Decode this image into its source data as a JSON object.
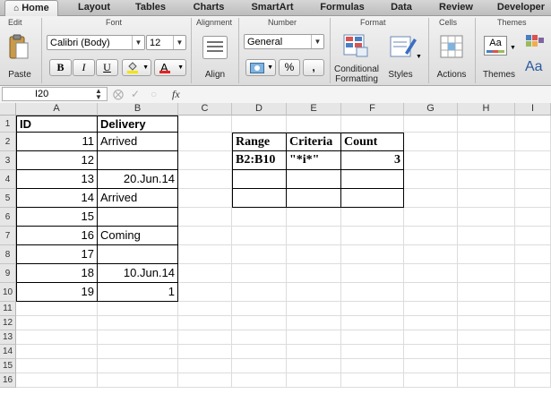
{
  "tabs": [
    {
      "label": "Home",
      "active": true
    },
    {
      "label": "Layout"
    },
    {
      "label": "Tables"
    },
    {
      "label": "Charts"
    },
    {
      "label": "SmartArt"
    },
    {
      "label": "Formulas"
    },
    {
      "label": "Data"
    },
    {
      "label": "Review"
    },
    {
      "label": "Developer"
    }
  ],
  "ribbon": {
    "groups": {
      "edit": "Edit",
      "font": "Font",
      "alignment": "Alignment",
      "number": "Number",
      "format": "Format",
      "cells": "Cells",
      "themes": "Themes"
    },
    "paste_label": "Paste",
    "font_name": "Calibri (Body)",
    "font_size": "12",
    "bold": "B",
    "italic": "I",
    "underline": "U",
    "font_color_glyph": "A",
    "align_label": "Align",
    "number_format": "General",
    "percent": "%",
    "comma": ",",
    "conditional_formatting_line1": "Conditional",
    "conditional_formatting_line2": "Formatting",
    "styles_label": "Styles",
    "actions_label": "Actions",
    "themes_label": "Themes",
    "themes_preview": "Aa",
    "font_aa": "Aa"
  },
  "formula_bar": {
    "name_box": "I20",
    "fx": "fx",
    "formula": ""
  },
  "sheet": {
    "columns": [
      "A",
      "B",
      "C",
      "D",
      "E",
      "F",
      "G",
      "H",
      "I"
    ],
    "rows": [
      "1",
      "2",
      "3",
      "4",
      "5",
      "6",
      "7",
      "8",
      "9",
      "10",
      "11",
      "12",
      "13",
      "14",
      "15",
      "16"
    ],
    "cells": {
      "A1": "ID",
      "B1": "Delivery",
      "A2": "11",
      "B2": "Arrived",
      "A3": "12",
      "B3": "",
      "A4": "13",
      "B4": "20.Jun.14",
      "A5": "14",
      "B5": "Arrived",
      "A6": "15",
      "B6": "",
      "A7": "16",
      "B7": "Coming",
      "A8": "17",
      "B8": "",
      "A9": "18",
      "B9": "10.Jun.14",
      "A10": "19",
      "B10": "1",
      "D2": "Range",
      "E2": "Criteria",
      "F2": "Count",
      "D3": "B2:B10",
      "E3": "\"*i*\"",
      "F3": "3"
    }
  }
}
